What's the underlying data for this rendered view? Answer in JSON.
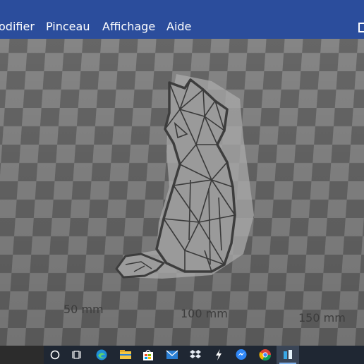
{
  "menubar": {
    "items": [
      "odifier",
      "Pinceau",
      "Affichage",
      "Aide"
    ]
  },
  "viewport": {
    "ruler_labels": [
      "50 mm",
      "100 mm",
      "150 mm"
    ],
    "model": "cat-lowpoly-model"
  },
  "taskbar": {
    "icons": [
      "cortana-search-icon",
      "task-view-icon",
      "edge-icon",
      "file-explorer-icon",
      "store-icon",
      "mail-icon",
      "dropbox-icon",
      "lightning-app-icon",
      "messenger-icon",
      "chrome-icon",
      "slicer-app-icon"
    ]
  },
  "colors": {
    "menubar": "#2b4d9c",
    "checker_light": "#8c8c8c",
    "checker_dark": "#6b6b6b",
    "taskbar": "#1f2733"
  }
}
